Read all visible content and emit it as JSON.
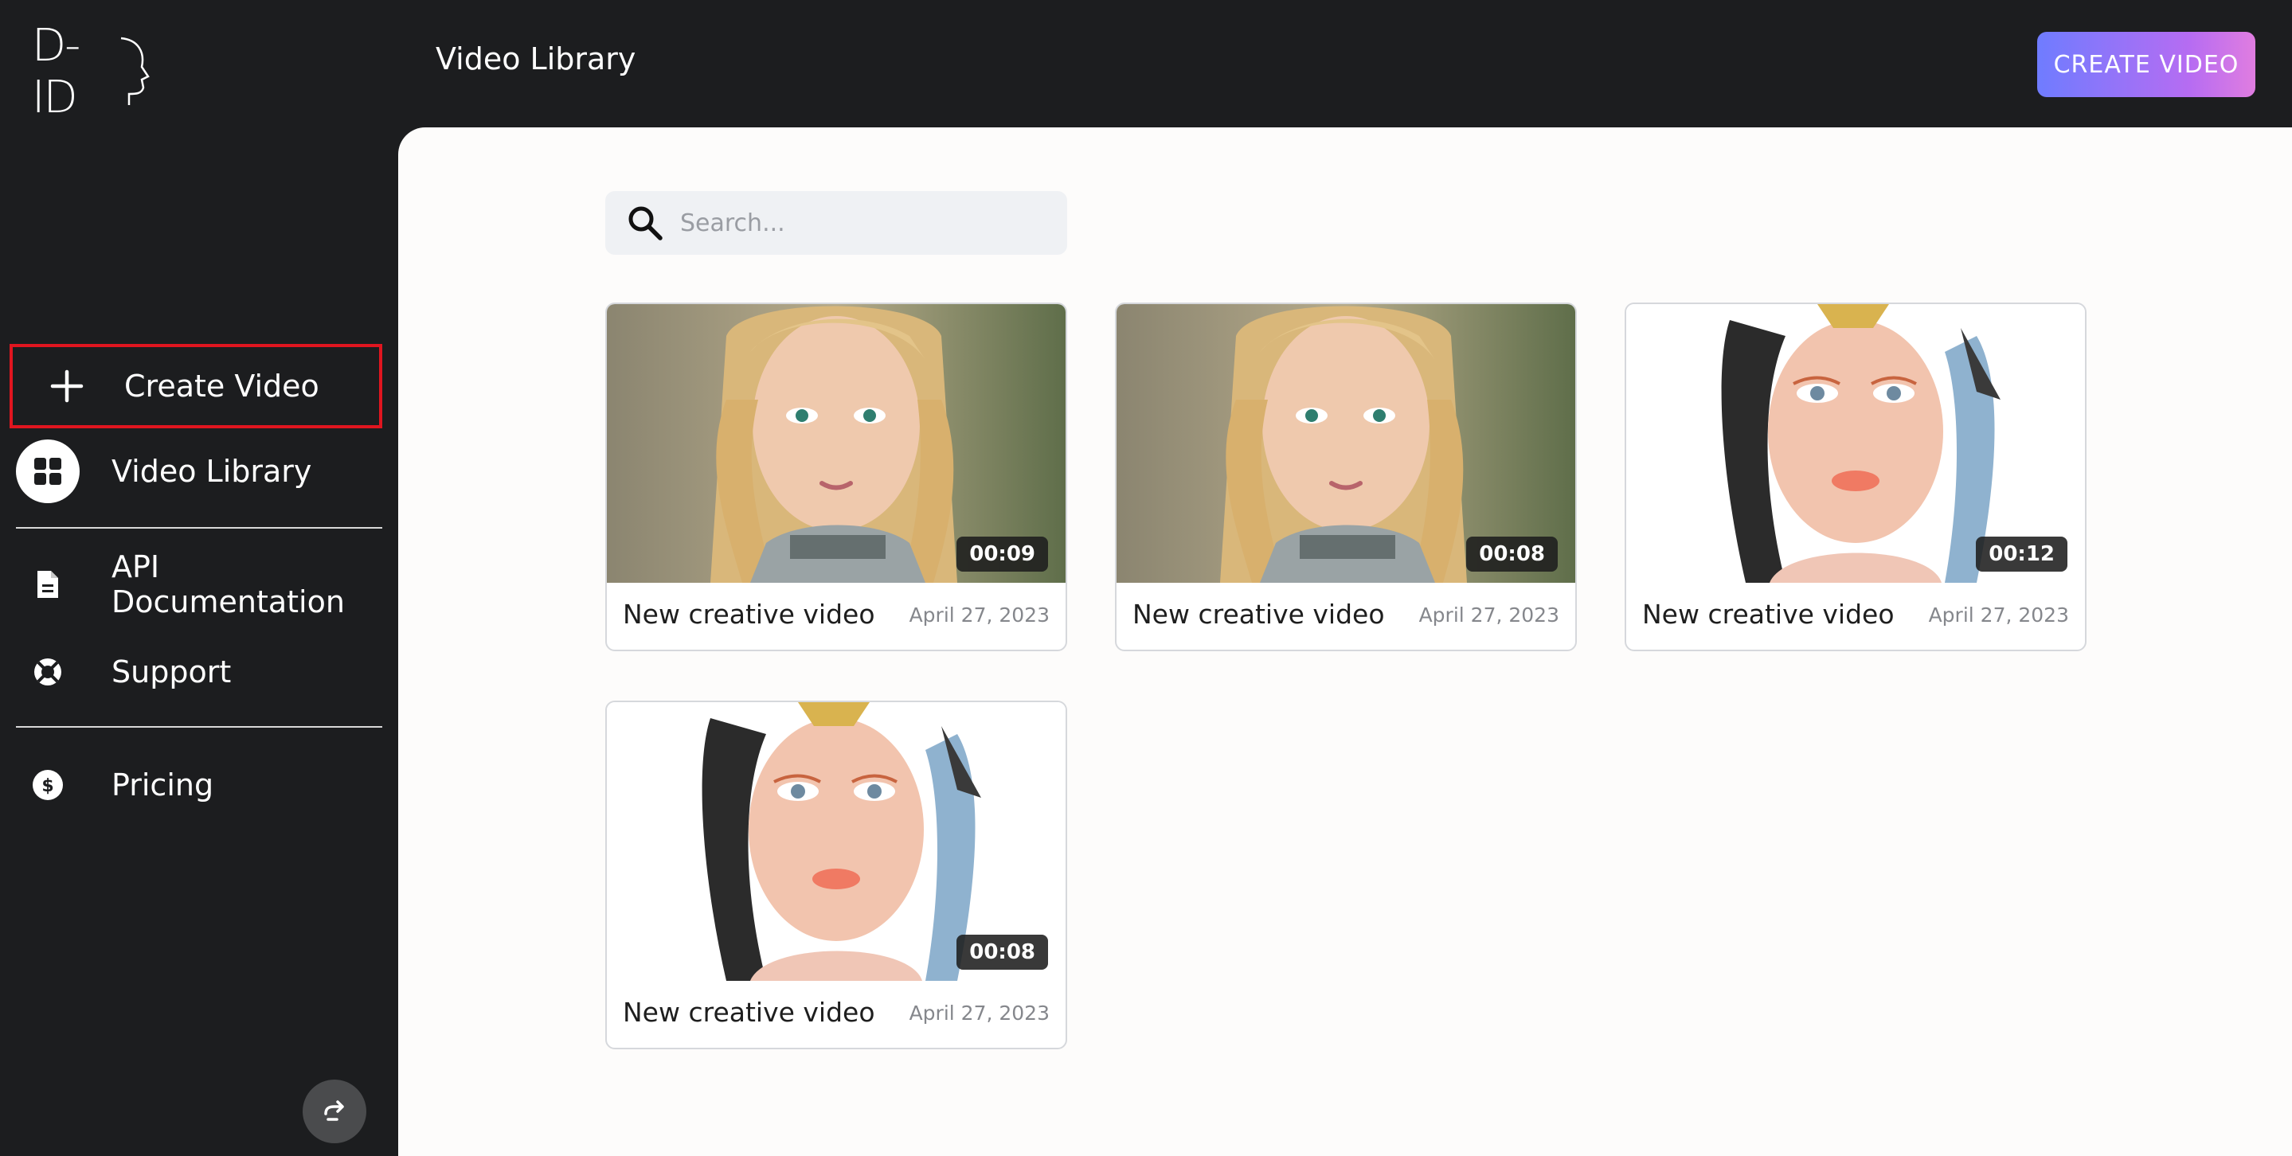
{
  "app": {
    "logo_text": "D-ID",
    "page_title": "Video Library",
    "create_button_label": "CREATE VIDEO"
  },
  "sidebar": {
    "items": [
      {
        "label": "Create Video",
        "icon": "plus-icon",
        "highlighted": true
      },
      {
        "label": "Video Library",
        "icon": "grid-icon",
        "active": true
      },
      {
        "label": "API Documentation",
        "icon": "document-icon"
      },
      {
        "label": "Support",
        "icon": "lifebuoy-icon"
      },
      {
        "label": "Pricing",
        "icon": "dollar-icon"
      }
    ],
    "collapse_icon": "redo-arrow-icon"
  },
  "search": {
    "placeholder": "Search...",
    "value": ""
  },
  "videos": [
    {
      "title": "New creative video",
      "date": "April 27, 2023",
      "duration": "00:09",
      "thumbnail": "blonde-braided-girl-portrait"
    },
    {
      "title": "New creative video",
      "date": "April 27, 2023",
      "duration": "00:08",
      "thumbnail": "blonde-braided-girl-portrait"
    },
    {
      "title": "New creative video",
      "date": "April 27, 2023",
      "duration": "00:12",
      "thumbnail": "feathered-fantasy-girl-portrait"
    },
    {
      "title": "New creative video",
      "date": "April 27, 2023",
      "duration": "00:08",
      "thumbnail": "feathered-fantasy-girl-portrait"
    }
  ],
  "colors": {
    "sidebar_bg": "#1c1d1f",
    "main_bg": "#fdfcfb",
    "highlight_border": "#e0151f",
    "button_gradient_start": "#6f7cff",
    "button_gradient_end": "#e07de0"
  }
}
